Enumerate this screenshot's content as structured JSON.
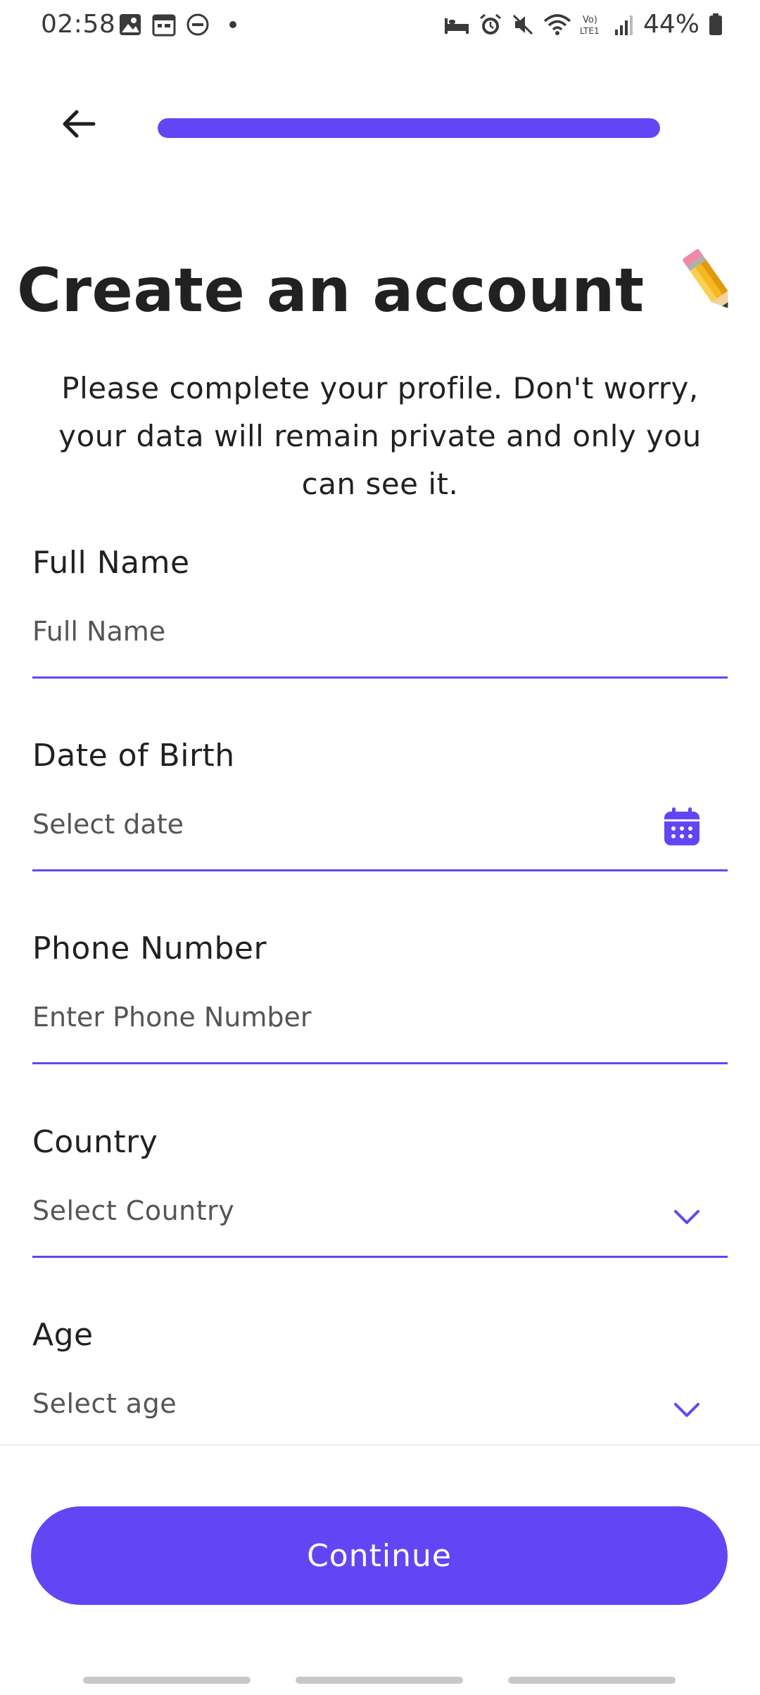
{
  "status_bar": {
    "time": "02:58",
    "battery": "44%",
    "left_icons": [
      "gallery-icon",
      "calendar-notification-icon",
      "do-not-disturb-icon"
    ],
    "right_icons": [
      "sleep-mode-icon",
      "alarm-icon",
      "mute-icon",
      "wifi-icon",
      "volte-icon",
      "signal-icon",
      "battery-icon"
    ]
  },
  "header": {
    "progress": 1.0,
    "accent_color": "#6246f5"
  },
  "title": "Create an account",
  "subtitle": "Please complete your profile. Don't worry, your data will remain private and only you can see it.",
  "form": {
    "full_name": {
      "label": "Full Name",
      "placeholder": "Full Name"
    },
    "dob": {
      "label": "Date of Birth",
      "placeholder": "Select date"
    },
    "phone": {
      "label": "Phone Number",
      "placeholder": "Enter Phone Number"
    },
    "country": {
      "label": "Country",
      "value": "Select Country"
    },
    "age": {
      "label": "Age",
      "value": "Select age"
    }
  },
  "continue_label": "Continue"
}
